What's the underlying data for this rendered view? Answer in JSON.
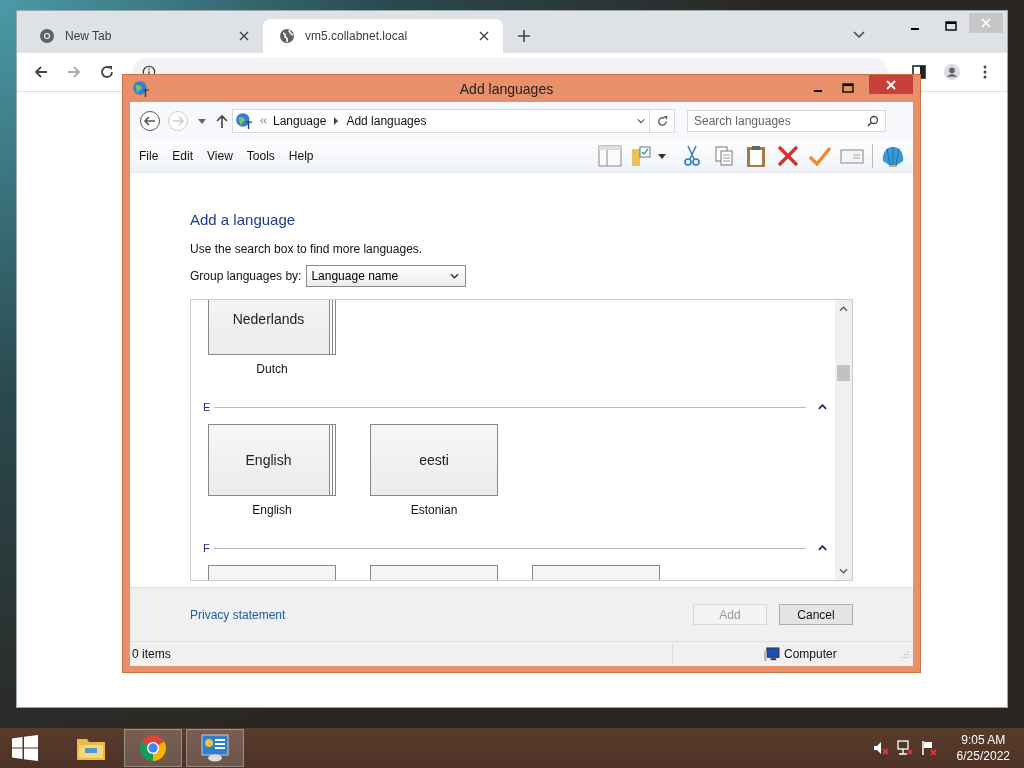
{
  "browser": {
    "tabs": [
      {
        "title": "New Tab",
        "selected": false
      },
      {
        "title": "vm5.collabnet.local",
        "selected": true
      }
    ]
  },
  "dialog": {
    "title": "Add languages",
    "breadcrumb": [
      "Language",
      "Add languages"
    ],
    "search": {
      "placeholder": "Search languages"
    },
    "menu": [
      "File",
      "Edit",
      "View",
      "Tools",
      "Help"
    ],
    "heading": "Add a language",
    "hint": "Use the search box to find more languages.",
    "group_by": {
      "label": "Group languages by:",
      "value": "Language name"
    },
    "groups": [
      {
        "tiles": [
          {
            "kind": "language",
            "native": "Nederlands",
            "name": "Dutch",
            "stacked": true
          }
        ]
      },
      {
        "letter": "E",
        "expanded": true,
        "tiles": [
          {
            "kind": "language",
            "native": "English",
            "name": "English",
            "stacked": true
          },
          {
            "kind": "language",
            "native": "eesti",
            "name": "Estonian",
            "stacked": false
          }
        ]
      },
      {
        "letter": "F",
        "expanded": true,
        "tiles": [
          {
            "kind": "blank"
          },
          {
            "kind": "blank"
          },
          {
            "kind": "blank"
          }
        ]
      }
    ],
    "privacy_link": "Privacy statement",
    "buttons": [
      {
        "label": "Add",
        "disabled": true
      },
      {
        "label": "Cancel",
        "disabled": false
      }
    ],
    "status": {
      "items": "0 items",
      "location": "Computer"
    }
  },
  "taskbar": {
    "apps": [
      {
        "kind": "explorer",
        "selected": false
      },
      {
        "kind": "chrome",
        "selected": true
      },
      {
        "kind": "control-panel",
        "selected": true
      }
    ],
    "time": "9:05 AM",
    "date": "6/25/2022"
  }
}
